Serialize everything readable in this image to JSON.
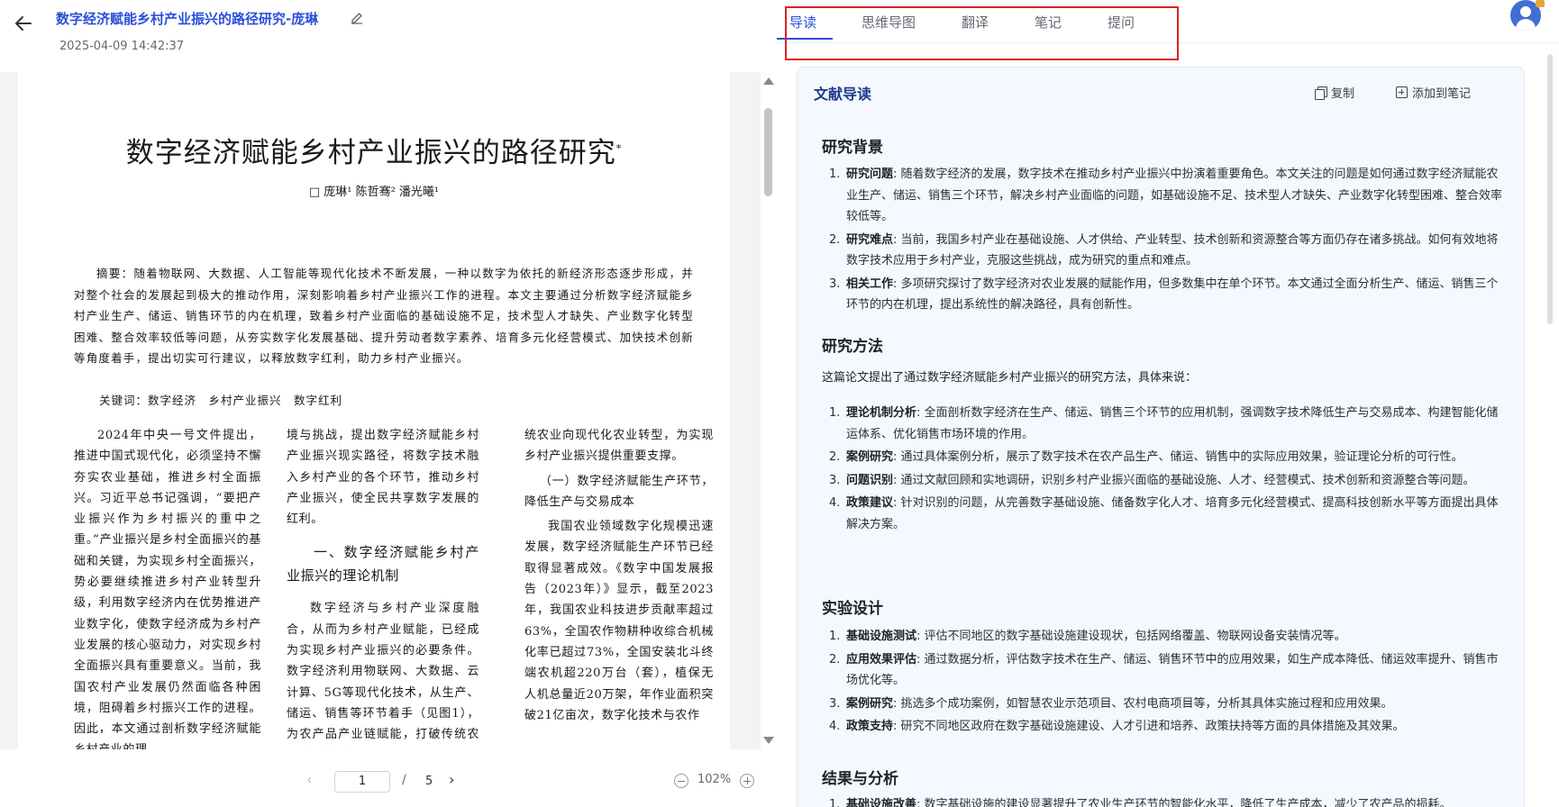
{
  "header": {
    "title": "数字经济赋能乡村产业振兴的路径研究-庞琳",
    "timestamp": "2025-04-09 14:42:37"
  },
  "paper": {
    "title": "数字经济赋能乡村产业振兴的路径研究",
    "title_mark": "*",
    "authors": "□ 庞琳¹ 陈哲骞² 潘光曦¹",
    "abstract": "摘要：随着物联网、大数据、人工智能等现代化技术不断发展，一种以数字为依托的新经济形态逐步形成，并对整个社会的发展起到极大的推动作用，深刻影响着乡村产业振兴工作的进程。本文主要通过分析数字经济赋能乡村产业生产、储运、销售环节的内在机理，致着乡村产业面临的基础设施不足，技术型人才缺失、产业数字化转型困难、整合效率较低等问题，从夯实数字化发展基础、提升劳动者数字素养、培育多元化经营模式、加快技术创新等角度着手，提出切实可行建议，以释放数字红利，助力乡村产业振兴。",
    "keywords": "关键词：数字经济　乡村产业振兴　数字红利",
    "col1": "2024年中央一号文件提出，推进中国式现代化，必须坚持不懈夯实农业基础，推进乡村全面振兴。习近平总书记强调，“要把产业振兴作为乡村振兴的重中之重。”产业振兴是乡村全面振兴的基础和关键，为实现乡村全面振兴，势必要继续推进乡村产业转型升级，利用数字经济内在优势推进产业数字化，使数字经济成为乡村产业发展的核心驱动力，对实现乡村全面振兴具有重要意义。当前，我国农村产业发展仍然面临各种困境，阻碍着乡村振兴工作的进程。因此，本文通过剖析数字经济赋能乡村产业的理",
    "col2_p1": "境与挑战，提出数字经济赋能乡村产业振兴现实路径，将数字技术融入乡村产业的各个环节，推动乡村产业振兴，使全民共享数字发展的红利。",
    "col2_heading": "一、数字经济赋能乡村产业振兴的理论机制",
    "col2_p2": "数字经济与乡村产业深度融合，从而为乡村产业赋能，已经成为实现乡村产业振兴的必要条件。数字经济利用物联网、大数据、云计算、5G等现代化技术，从生产、储运、销售等环节着手（见图1），为农产品产业链赋能，打破传统农业发展的时",
    "col3_p1": "统农业向现代化农业转型，为实现乡村产业振兴提供重要支撑。",
    "col3_sub": "（一）数字经济赋能生产环节，降低生产与交易成本",
    "col3_p2": "我国农业领域数字化规模迅速发展，数字经济赋能生产环节已经取得显著成效。《数字中国发展报告（2023年）》显示，截至2023年，我国农业科技进步贡献率超过63%，全国农作物耕种收综合机械化率已超过73%，全国安装北斗终端农机超220万台（套），植保无人机总量近20万架，年作业面积突破21亿亩次，数字化技术与农作"
  },
  "pager": {
    "prev": "‹",
    "current_page": "1",
    "separator": "/",
    "total_pages": "5",
    "next": "›",
    "zoom": "102%"
  },
  "tabs": [
    {
      "label": "导读"
    },
    {
      "label": "思维导图"
    },
    {
      "label": "翻译"
    },
    {
      "label": "笔记"
    },
    {
      "label": "提问"
    }
  ],
  "panel": {
    "title": "文献导读",
    "copy_label": "复制",
    "add_note_label": "添加到笔记"
  },
  "sections": [
    {
      "title": "研究背景",
      "items": [
        {
          "num": "1.",
          "label": "研究问题",
          "text": ": 随着数字经济的发展，数字技术在推动乡村产业振兴中扮演着重要角色。本文关注的问题是如何通过数字经济赋能农业生产、储运、销售三个环节，解决乡村产业面临的问题，如基础设施不足、技术型人才缺失、产业数字化转型困难、整合效率较低等。"
        },
        {
          "num": "2.",
          "label": "研究难点",
          "text": ": 当前，我国乡村产业在基础设施、人才供给、产业转型、技术创新和资源整合等方面仍存在诸多挑战。如何有效地将数字技术应用于乡村产业，克服这些挑战，成为研究的重点和难点。"
        },
        {
          "num": "3.",
          "label": "相关工作",
          "text": ": 多项研究探讨了数字经济对农业发展的赋能作用，但多数集中在单个环节。本文通过全面分析生产、储运、销售三个环节的内在机理，提出系统性的解决路径，具有创新性。"
        }
      ]
    },
    {
      "title": "研究方法",
      "intro": "这篇论文提出了通过数字经济赋能乡村产业振兴的研究方法，具体来说：",
      "items": [
        {
          "num": "1.",
          "label": "理论机制分析",
          "text": ": 全面剖析数字经济在生产、储运、销售三个环节的应用机制，强调数字技术降低生产与交易成本、构建智能化储运体系、优化销售市场环境的作用。"
        },
        {
          "num": "2.",
          "label": "案例研究",
          "text": ": 通过具体案例分析，展示了数字技术在农产品生产、储运、销售中的实际应用效果，验证理论分析的可行性。"
        },
        {
          "num": "3.",
          "label": "问题识别",
          "text": ": 通过文献回顾和实地调研，识别乡村产业振兴面临的基础设施、人才、经营模式、技术创新和资源整合等问题。"
        },
        {
          "num": "4.",
          "label": "政策建议",
          "text": ": 针对识别的问题，从完善数字基础设施、储备数字化人才、培育多元化经营模式、提高科技创新水平等方面提出具体解决方案。"
        }
      ]
    },
    {
      "title": "实验设计",
      "items": [
        {
          "num": "1.",
          "label": "基础设施测试",
          "text": ": 评估不同地区的数字基础设施建设现状，包括网络覆盖、物联网设备安装情况等。"
        },
        {
          "num": "2.",
          "label": "应用效果评估",
          "text": ": 通过数据分析，评估数字技术在生产、储运、销售环节中的应用效果，如生产成本降低、储运效率提升、销售市场优化等。"
        },
        {
          "num": "3.",
          "label": "案例研究",
          "text": ": 挑选多个成功案例，如智慧农业示范项目、农村电商项目等，分析其具体实施过程和应用效果。"
        },
        {
          "num": "4.",
          "label": "政策支持",
          "text": ": 研究不同地区政府在数字基础设施建设、人才引进和培养、政策扶持等方面的具体措施及其效果。"
        }
      ]
    },
    {
      "title": "结果与分析",
      "items": [
        {
          "num": "1.",
          "label": "基础设施改善",
          "text": ": 数字基础设施的建设显著提升了农业生产环节的智能化水平，降低了生产成本，减少了农产品的损耗。"
        }
      ]
    }
  ]
}
